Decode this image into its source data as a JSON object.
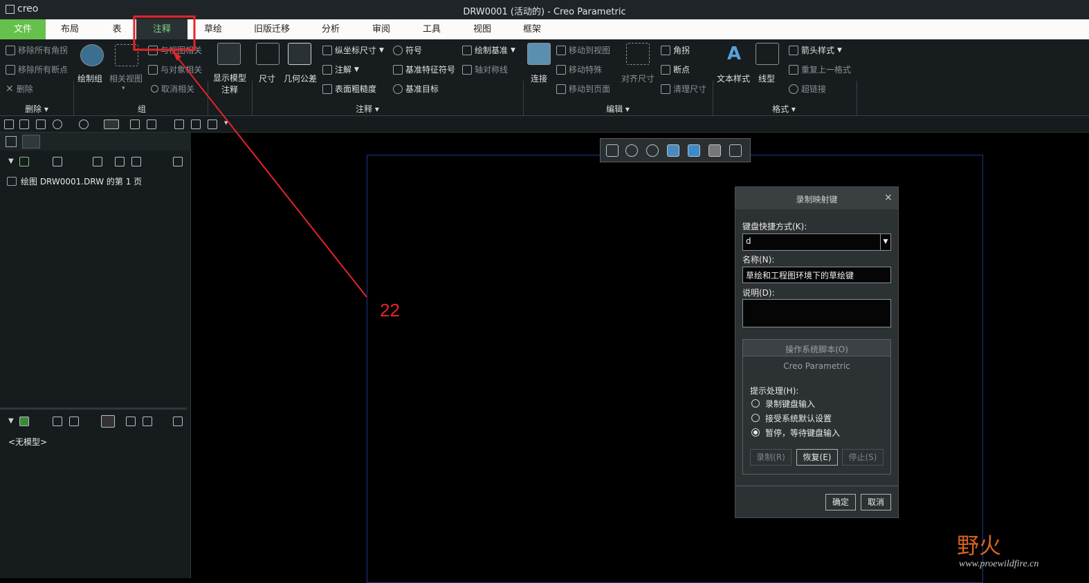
{
  "window": {
    "app_logo": "creo",
    "title": "DRW0001 (活动的) - Creo Parametric"
  },
  "tabs": [
    "文件",
    "布局",
    "表",
    "注释",
    "草绘",
    "旧版迁移",
    "分析",
    "审阅",
    "工具",
    "视图",
    "框架"
  ],
  "ribbon": {
    "delete_group": {
      "items": [
        "移除所有角拐",
        "移除所有断点",
        "删除"
      ],
      "label": "删除"
    },
    "group_group": {
      "draw_group": "绘制组",
      "related_view": "相关视图",
      "items": [
        "与视图相关",
        "与对象相关",
        "取消相关"
      ],
      "label": "组"
    },
    "show_model_annot": "显示模型\n注释",
    "annot_group": {
      "dimension": "尺寸",
      "gtol": "几何公差",
      "items": [
        "纵坐标尺寸",
        "注解",
        "表面粗糙度",
        "符号",
        "基准特征符号",
        "基准目标",
        "绘制基准",
        "轴对称线"
      ],
      "label": "注释"
    },
    "edit_group": {
      "connect": "连接",
      "align_dim": "对齐尺寸",
      "items": [
        "移动到视图",
        "移动特殊",
        "移动到页面",
        "角拐",
        "断点",
        "清理尺寸"
      ],
      "label": "编辑"
    },
    "format_group": {
      "text_style": "文本样式",
      "line_style": "线型",
      "items": [
        "箭头样式",
        "重复上一格式",
        "超链接"
      ],
      "label": "格式"
    }
  },
  "model_tree": {
    "drawing_item": "绘图 DRW0001.DRW 的第 1 页",
    "no_model": "<无模型>"
  },
  "annotation_number": "22",
  "dialog": {
    "title": "录制映射键",
    "shortcut_label": "键盘快捷方式(K):",
    "shortcut_value": "d",
    "name_label": "名称(N):",
    "name_value": "草绘和工程图环境下的草绘键",
    "desc_label": "说明(D):",
    "desc_value": "",
    "os_script_tab": "操作系统脚本(O)",
    "creo_tab": "Creo Parametric",
    "prompt_label": "提示处理(H):",
    "options": [
      "录制键盘输入",
      "接受系统默认设置",
      "暂停，等待键盘输入"
    ],
    "selected_option": 2,
    "record_btn": "录制(R)",
    "resume_btn": "恢复(E)",
    "stop_btn": "停止(S)",
    "ok_btn": "确定",
    "cancel_btn": "取消"
  },
  "watermark": {
    "text": "野火",
    "url": "www.proewildfire.cn"
  },
  "colors": {
    "accent": "#66c04c",
    "annotation": "#e8232a"
  }
}
